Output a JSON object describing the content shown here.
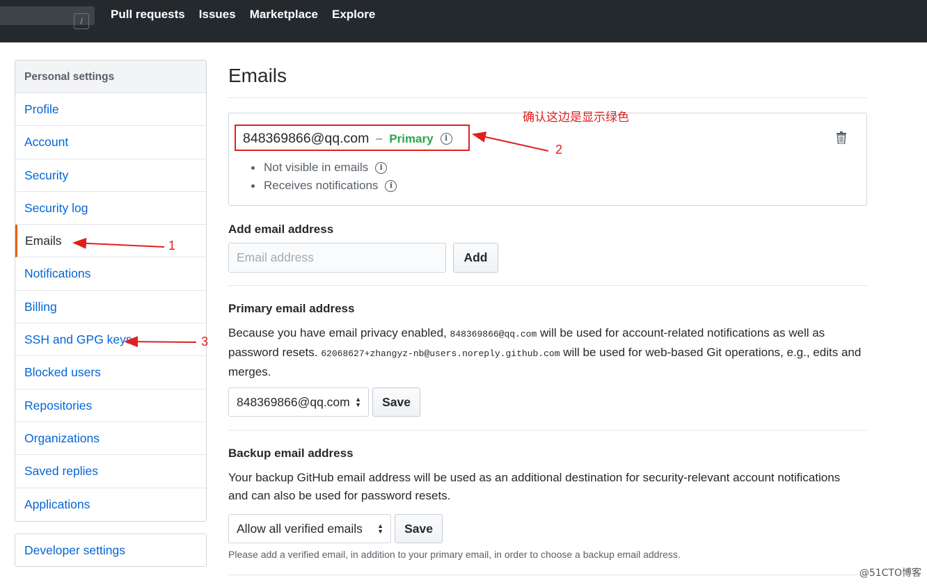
{
  "header": {
    "search_shortcut": "/",
    "nav": [
      "Pull requests",
      "Issues",
      "Marketplace",
      "Explore"
    ]
  },
  "sidebar": {
    "heading": "Personal settings",
    "items": [
      {
        "label": "Profile"
      },
      {
        "label": "Account"
      },
      {
        "label": "Security"
      },
      {
        "label": "Security log"
      },
      {
        "label": "Emails",
        "selected": true
      },
      {
        "label": "Notifications"
      },
      {
        "label": "Billing"
      },
      {
        "label": "SSH and GPG keys"
      },
      {
        "label": "Blocked users"
      },
      {
        "label": "Repositories"
      },
      {
        "label": "Organizations"
      },
      {
        "label": "Saved replies"
      },
      {
        "label": "Applications"
      }
    ],
    "developer_settings": "Developer settings"
  },
  "main": {
    "title": "Emails",
    "email_entry": {
      "address": "848369866@qq.com",
      "separator": "–",
      "badge": "Primary",
      "details": [
        "Not visible in emails",
        "Receives notifications"
      ]
    },
    "add_email": {
      "title": "Add email address",
      "placeholder": "Email address",
      "button": "Add"
    },
    "primary_email": {
      "title": "Primary email address",
      "text_1": "Because you have email privacy enabled, ",
      "code_1": "848369866@qq.com",
      "text_2": " will be used for account-related notifications as well as password resets. ",
      "code_2": "62068627+zhangyz-nb@users.noreply.github.com",
      "text_3": " will be used for web-based Git operations, e.g., edits and merges.",
      "select_value": "848369866@qq.com",
      "button": "Save"
    },
    "backup_email": {
      "title": "Backup email address",
      "text": "Your backup GitHub email address will be used as an additional destination for security-relevant account notifications and can also be used for password resets.",
      "select_value": "Allow all verified emails",
      "button": "Save",
      "note": "Please add a verified email, in addition to your primary email, in order to choose a backup email address."
    }
  },
  "annotations": {
    "note_cn": "确认这边是显示绿色",
    "label_1": "1",
    "label_2": "2",
    "label_3": "3",
    "color": "#e01f1f"
  },
  "watermark": "@51CTO博客",
  "colors": {
    "header_bg": "#24292e",
    "link": "#0366d6",
    "primary_badge": "#28a745",
    "selected_accent": "#e36209"
  }
}
